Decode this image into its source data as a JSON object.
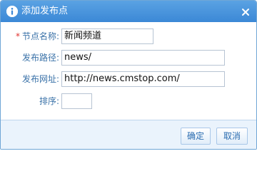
{
  "dialog": {
    "title": "添加发布点",
    "icon": "info-icon",
    "close_icon": "close-icon"
  },
  "form": {
    "name": {
      "required_mark": "*",
      "label": "节点名称:",
      "value": "新闻频道"
    },
    "path": {
      "label": "发布路径:",
      "value": "news/"
    },
    "url": {
      "label": "发布网址:",
      "value": "http://news.cmstop.com/"
    },
    "sort": {
      "label": "排序:",
      "value": ""
    }
  },
  "buttons": {
    "ok": "确定",
    "cancel": "取消"
  },
  "colors": {
    "titlebar": "#3b88d6",
    "label": "#3a72a8",
    "required": "#e0302d",
    "footer": "#eaf3fc"
  }
}
